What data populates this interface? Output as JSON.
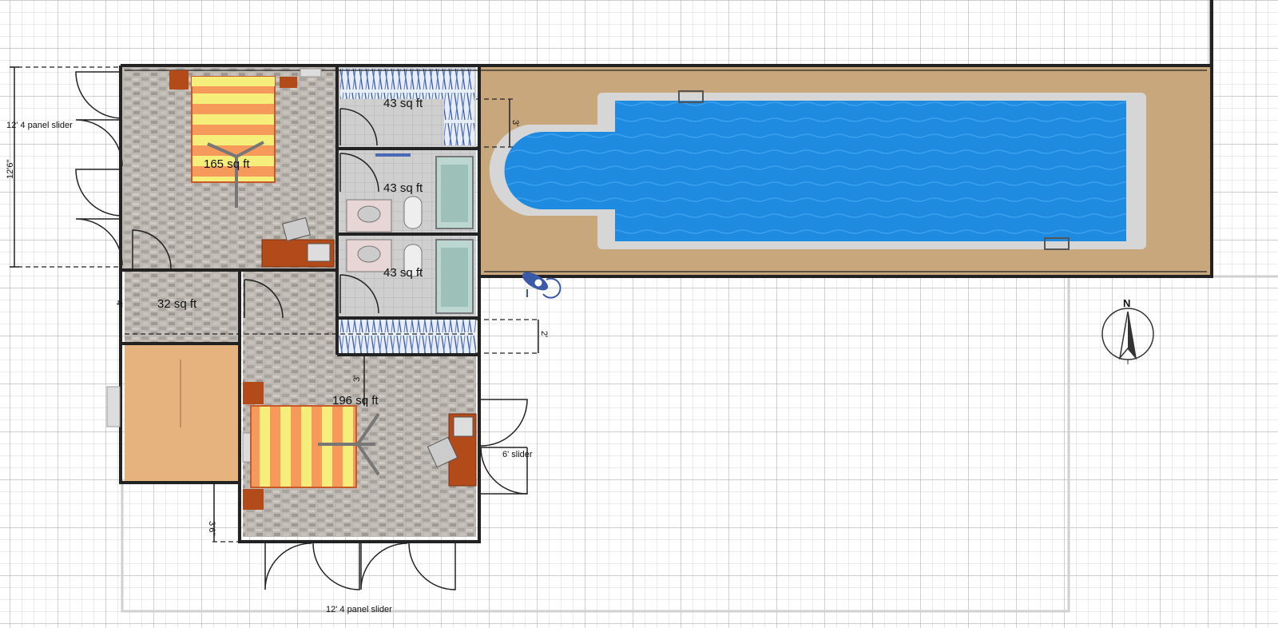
{
  "rooms": [
    {
      "name": "bedroom-1",
      "area_label": "165 sq ft"
    },
    {
      "name": "closet-top",
      "area_label": "43 sq ft"
    },
    {
      "name": "bath-1",
      "area_label": "43 sq ft"
    },
    {
      "name": "bath-2",
      "area_label": "43 sq ft"
    },
    {
      "name": "hall",
      "area_label": "32 sq ft"
    },
    {
      "name": "bedroom-2",
      "area_label": "196 sq ft"
    }
  ],
  "door_labels": {
    "left_slider": "12' 4 panel slider",
    "right_slider": "6' slider",
    "bottom_slider": "12' 4 panel slider"
  },
  "dimensions": {
    "left_height": "12'6\"",
    "closet_depth": "3'",
    "closet_2": "2'",
    "hall_gap": "4'",
    "bedroom2_offset": "3'",
    "bottom_step": "3'6\""
  },
  "compass": {
    "north_label": "N"
  },
  "colors": {
    "wall": "#222222",
    "pool_water": "#1e8be0",
    "pool_deck": "#c9a77c",
    "floor_stone": "#b9b4ae",
    "floor_wood": "#e6b27e",
    "bed_orange": "#f59a5a",
    "bed_yellow": "#f6ee7a",
    "grid": "#c8c8c8"
  }
}
